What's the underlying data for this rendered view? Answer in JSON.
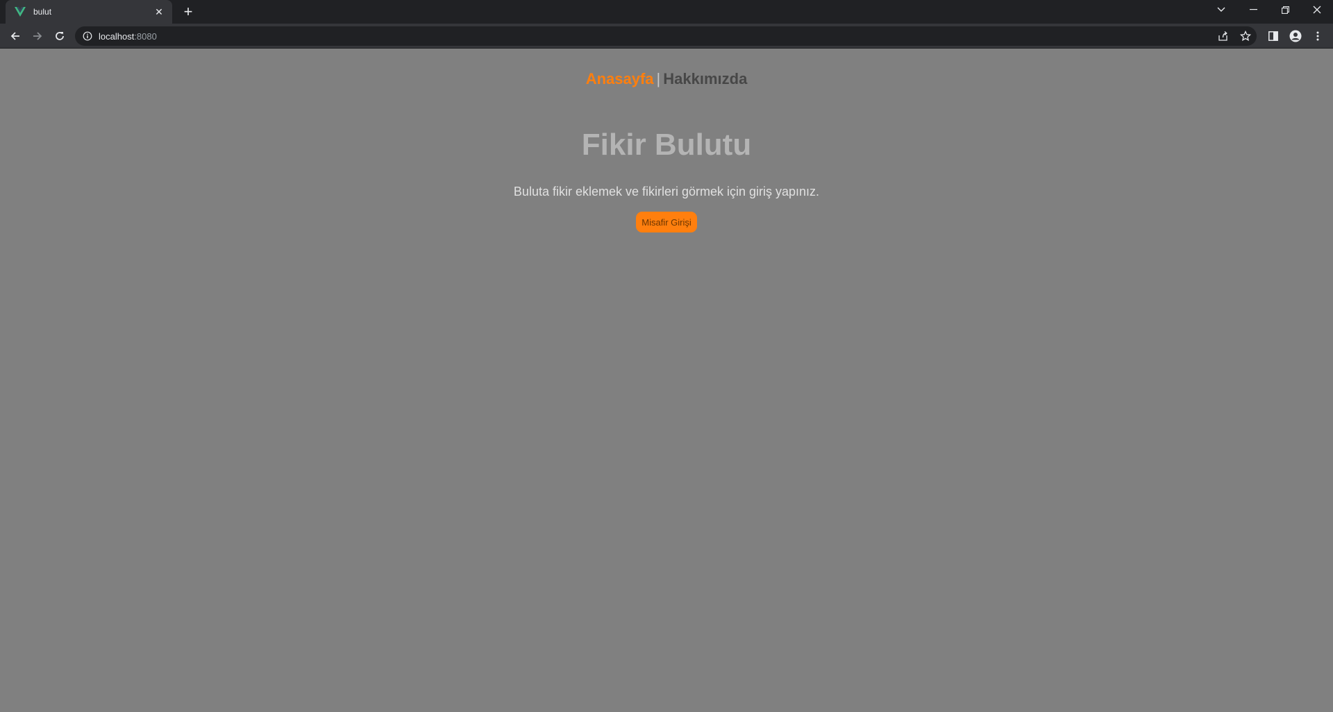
{
  "browser": {
    "tab_title": "bulut",
    "url_host": "localhost",
    "url_port": ":8080",
    "favicon": "vue-logo-icon"
  },
  "nav": {
    "home": "Anasayfa",
    "separator": "|",
    "about": "Hakkımızda"
  },
  "main": {
    "title": "Fikir Bulutu",
    "subtitle": "Buluta fikir eklemek ve fikirleri görmek için giriş yapınız.",
    "guest_button": "Misafir Girişi"
  },
  "colors": {
    "accent": "#ff7f0e",
    "background": "#808080"
  }
}
